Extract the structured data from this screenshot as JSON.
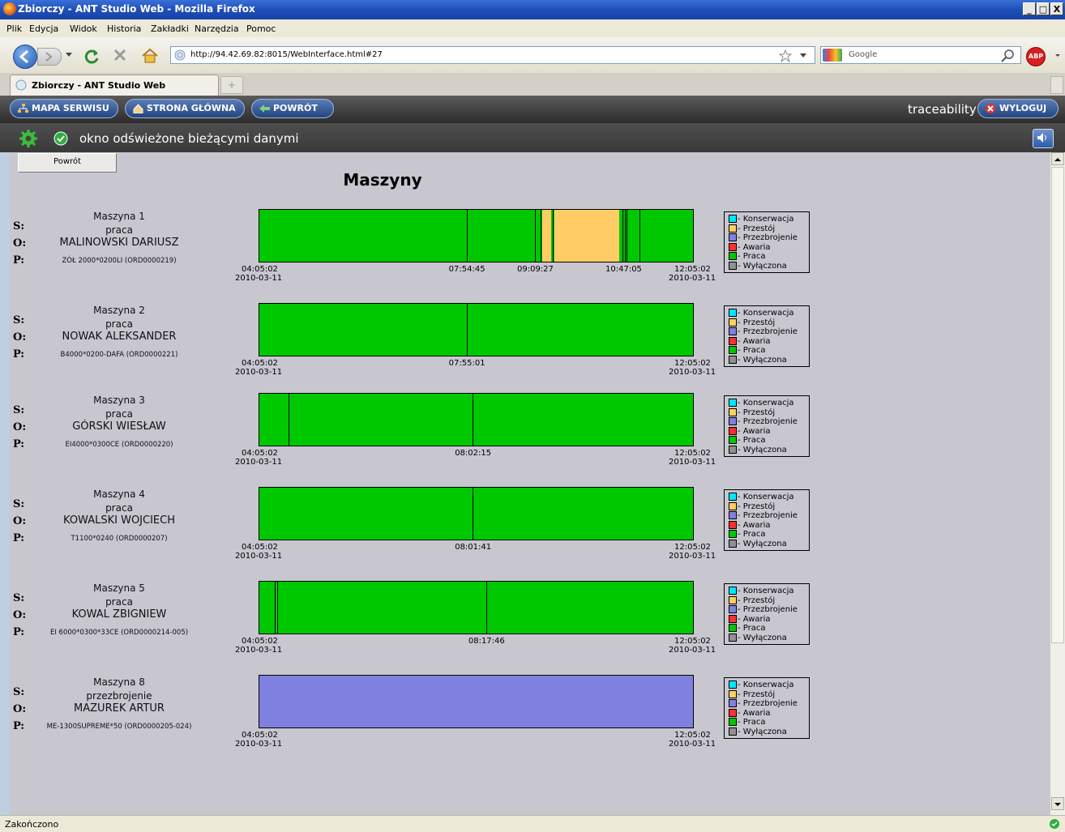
{
  "window": {
    "title": "Zbiorczy - ANT Studio Web - Mozilla Firefox",
    "min": "_",
    "max": "®",
    "close": "X"
  },
  "menu": [
    "Plik",
    "Edycja",
    "Widok",
    "Historia",
    "Zakładki",
    "Narzędzia",
    "Pomoc"
  ],
  "nav": {
    "url": "http://94.42.69.82:8015/WebInterface.html#27",
    "search_placeholder": "Google"
  },
  "tab": {
    "label": "Zbiorczy - ANT Studio Web",
    "new_tab": "+"
  },
  "app": {
    "btn_sitemap": "MAPA SERWISU",
    "btn_home": "STRONA GŁÓWNA",
    "btn_back": "POWRÓT",
    "user": "traceability",
    "btn_logout": "WYLOGUJ",
    "refresh_status": "okno odświeżone bieżącymi danymi"
  },
  "page": {
    "back_button": "Powrót",
    "title": "Maszyny",
    "row_labels": {
      "s": "S:",
      "o": "O:",
      "p": "P:"
    },
    "legend": [
      {
        "label": "- Konserwacja",
        "color": "#00e8ff"
      },
      {
        "label": "- Przestój",
        "color": "#ffd060"
      },
      {
        "label": "- Przezbrojenie",
        "color": "#8080e0"
      },
      {
        "label": "- Awaria",
        "color": "#ff3030"
      },
      {
        "label": "- Praca",
        "color": "#00c800"
      },
      {
        "label": "- Wyłączona",
        "color": "#909090"
      }
    ],
    "state_colors": {
      "praca": "#00c800",
      "przestoj": "#ffcc66",
      "przezbrojenie": "#8080e0"
    },
    "machines": [
      {
        "name": "Maszyna 1",
        "state": "praca",
        "operator": "MALINOWSKI DARIUSZ",
        "product": "ZÓŁ 2000*0200LI (ORD0000219)",
        "start_time": "04:05:02",
        "start_date": "2010-03-11",
        "end_time": "12:05:02",
        "end_date": "2010-03-11",
        "segments": [
          {
            "from": 0,
            "to": 0.652,
            "state": "praca"
          },
          {
            "from": 0.652,
            "to": 0.672,
            "state": "przestoj"
          },
          {
            "from": 0.672,
            "to": 0.68,
            "state": "praca"
          },
          {
            "from": 0.68,
            "to": 0.83,
            "state": "przestoj"
          },
          {
            "from": 0.83,
            "to": 1,
            "state": "praca"
          }
        ],
        "ticks": [
          0.478,
          0.635,
          0.648,
          0.677,
          0.838,
          0.843,
          0.847,
          0.876
        ],
        "labels": [
          {
            "t": "07:54:45",
            "pos": 0.478
          },
          {
            "t": "09:09:27",
            "pos": 0.635
          },
          {
            "t": "10:47:05",
            "pos": 0.838
          }
        ]
      },
      {
        "name": "Maszyna 2",
        "state": "praca",
        "operator": "NOWAK ALEKSANDER",
        "product": "B4000*0200-DAFA (ORD0000221)",
        "start_time": "04:05:02",
        "start_date": "2010-03-11",
        "end_time": "12:05:02",
        "end_date": "2010-03-11",
        "segments": [
          {
            "from": 0,
            "to": 1,
            "state": "praca"
          }
        ],
        "ticks": [
          0.478
        ],
        "labels": [
          {
            "t": "07:55:01",
            "pos": 0.478
          }
        ]
      },
      {
        "name": "Maszyna 3",
        "state": "praca",
        "operator": "GÓRSKI WIESŁAW",
        "product": "EI4000*0300CE (ORD0000220)",
        "start_time": "04:05:02",
        "start_date": "2010-03-11",
        "end_time": "12:05:02",
        "end_date": "2010-03-11",
        "segments": [
          {
            "from": 0,
            "to": 1,
            "state": "praca"
          }
        ],
        "ticks": [
          0.068,
          0.492
        ],
        "labels": [
          {
            "t": "08:02:15",
            "pos": 0.492
          }
        ]
      },
      {
        "name": "Maszyna 4",
        "state": "praca",
        "operator": "KOWALSKI WOJCIECH",
        "product": "T1100*0240 (ORD0000207)",
        "start_time": "04:05:02",
        "start_date": "2010-03-11",
        "end_time": "12:05:02",
        "end_date": "2010-03-11",
        "segments": [
          {
            "from": 0,
            "to": 1,
            "state": "praca"
          }
        ],
        "ticks": [
          0.492
        ],
        "labels": [
          {
            "t": "08:01:41",
            "pos": 0.492
          }
        ]
      },
      {
        "name": "Maszyna 5",
        "state": "praca",
        "operator": "KOWAL ZBIGNIEW",
        "product": "EI 6000*0300*33CE (ORD0000214-005)",
        "start_time": "04:05:02",
        "start_date": "2010-03-11",
        "end_time": "12:05:02",
        "end_date": "2010-03-11",
        "segments": [
          {
            "from": 0,
            "to": 1,
            "state": "praca"
          }
        ],
        "ticks": [
          0.036,
          0.041,
          0.523
        ],
        "labels": [
          {
            "t": "08:17:46",
            "pos": 0.523
          }
        ]
      },
      {
        "name": "Maszyna 8",
        "state": "przezbrojenie",
        "operator": "MAZUREK ARTUR",
        "product": "ME-1300SUPREME*50 (ORD0000205-024)",
        "start_time": "04:05:02",
        "start_date": "2010-03-11",
        "end_time": "12:05:02",
        "end_date": "2010-03-11",
        "segments": [
          {
            "from": 0,
            "to": 1,
            "state": "przezbrojenie"
          }
        ],
        "ticks": [],
        "labels": []
      }
    ]
  },
  "statusbar": {
    "text": "Zakończono"
  }
}
